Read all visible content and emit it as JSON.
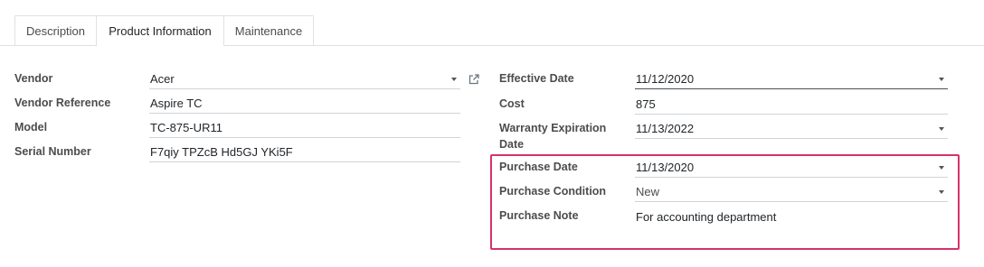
{
  "tabs": [
    {
      "label": "Description"
    },
    {
      "label": "Product Information"
    },
    {
      "label": "Maintenance"
    }
  ],
  "left": {
    "vendor": {
      "label": "Vendor",
      "value": "Acer"
    },
    "vendor_reference": {
      "label": "Vendor Reference",
      "value": "Aspire TC"
    },
    "model": {
      "label": "Model",
      "value": "TC-875-UR11"
    },
    "serial_number": {
      "label": "Serial Number",
      "value": "F7qiy TPZcB Hd5GJ YKi5F"
    }
  },
  "right": {
    "effective_date": {
      "label": "Effective Date",
      "value": "11/12/2020"
    },
    "cost": {
      "label": "Cost",
      "value": "875"
    },
    "warranty_expiration": {
      "label_line1": "Warranty Expiration",
      "label_line2": "Date",
      "value": "11/13/2022"
    },
    "purchase_date": {
      "label": "Purchase Date",
      "value": "11/13/2020"
    },
    "purchase_condition": {
      "label": "Purchase Condition",
      "value": "New"
    },
    "purchase_note": {
      "label": "Purchase Note",
      "value": "For accounting department"
    }
  },
  "colors": {
    "highlight": "#d63366"
  },
  "icons": {
    "vendor_external": "external-link-icon",
    "dropdown": "caret-down-icon"
  }
}
